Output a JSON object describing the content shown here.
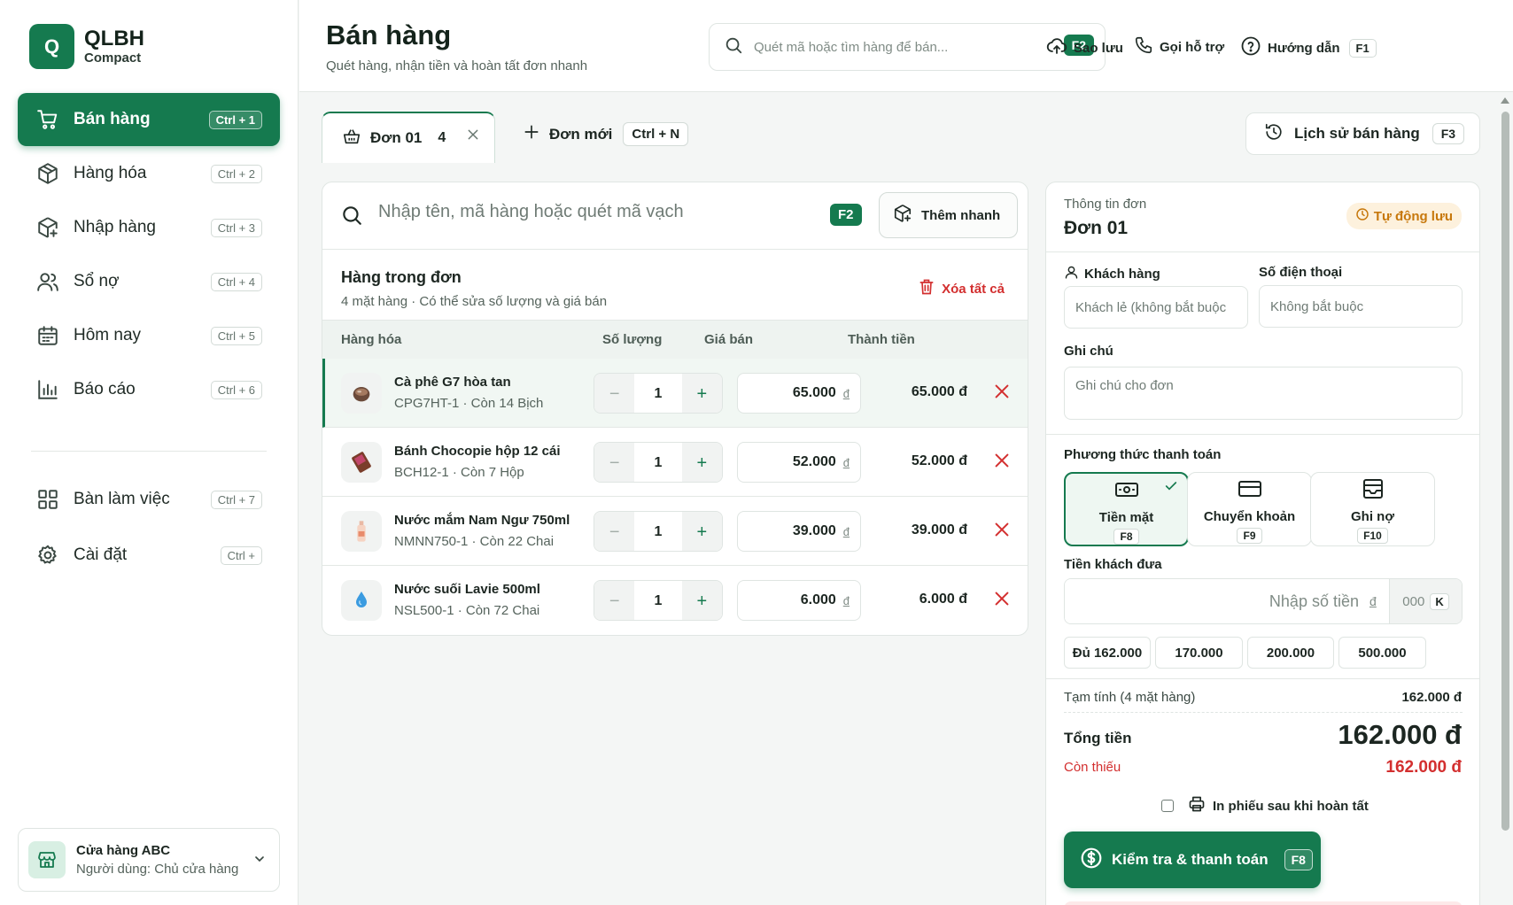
{
  "brand": {
    "logo_letter": "Q",
    "title": "QLBH",
    "subtitle": "Compact"
  },
  "sidebar": {
    "items": [
      {
        "label": "Bán hàng",
        "shortcut": "Ctrl + 1",
        "icon": "cart-icon",
        "active": true
      },
      {
        "label": "Hàng hóa",
        "shortcut": "Ctrl + 2",
        "icon": "box-icon"
      },
      {
        "label": "Nhập hàng",
        "shortcut": "Ctrl + 3",
        "icon": "box-import-icon"
      },
      {
        "label": "Sổ nợ",
        "shortcut": "Ctrl + 4",
        "icon": "users-icon"
      },
      {
        "label": "Hôm nay",
        "shortcut": "Ctrl + 5",
        "icon": "calendar-icon"
      },
      {
        "label": "Báo cáo",
        "shortcut": "Ctrl + 6",
        "icon": "bar-chart-icon"
      },
      {
        "label": "Bàn làm việc",
        "shortcut": "Ctrl + 7",
        "icon": "grid-icon"
      },
      {
        "label": "Cài đặt",
        "shortcut": "Ctrl +",
        "icon": "gear-icon"
      }
    ],
    "store": {
      "name": "Cửa hàng ABC",
      "user": "Người dùng: Chủ cửa hàng"
    }
  },
  "header": {
    "title": "Bán hàng",
    "subtitle": "Quét hàng, nhận tiền và hoàn tất đơn nhanh",
    "search_placeholder": "Quét mã hoặc tìm hàng để bán...",
    "search_shortcut": "F2",
    "backup": "Sao lưu",
    "support": "Gọi hỗ trợ",
    "guide": "Hướng dẫn",
    "guide_shortcut": "F1"
  },
  "tabs": {
    "active_label": "Đơn 01",
    "active_count": "4",
    "new_label": "Đơn mới",
    "new_shortcut": "Ctrl + N",
    "history_label": "Lịch sử bán hàng",
    "history_shortcut": "F3"
  },
  "order": {
    "search_placeholder": "Nhập tên, mã hàng hoặc quét mã vạch",
    "search_shortcut": "F2",
    "quick_add": "Thêm nhanh",
    "list_title": "Hàng trong đơn",
    "list_subtitle": "4 mặt hàng · Có thể sửa số lượng và giá bán",
    "clear_all": "Xóa tất cả",
    "columns": [
      "Hàng hóa",
      "Số lượng",
      "Giá bán",
      "Thành tiền"
    ],
    "currency": "đ",
    "items": [
      {
        "name": "Cà phê G7 hòa tan",
        "sku": "CPG7HT-1 · Còn 14 Bịch",
        "qty": "1",
        "price": "65.000",
        "total": "65.000 đ",
        "icon": "coffee-icon"
      },
      {
        "name": "Bánh Chocopie hộp 12 cái",
        "sku": "BCH12-1 · Còn 7 Hộp",
        "qty": "1",
        "price": "52.000",
        "total": "52.000 đ",
        "icon": "chocolate-icon"
      },
      {
        "name": "Nước mắm Nam Ngư 750ml",
        "sku": "NMNN750-1 · Còn 22 Chai",
        "qty": "1",
        "price": "39.000",
        "total": "39.000 đ",
        "icon": "bottle-icon"
      },
      {
        "name": "Nước suối Lavie 500ml",
        "sku": "NSL500-1 · Còn 72 Chai",
        "qty": "1",
        "price": "6.000",
        "total": "6.000 đ",
        "icon": "water-drop-icon"
      }
    ]
  },
  "panel": {
    "label": "Thông tin đơn",
    "title": "Đơn 01",
    "autosave": "Tự động lưu",
    "customer_label": "Khách hàng",
    "customer_placeholder": "Khách lẻ (không bắt buộc",
    "phone_label": "Số điện thoại",
    "phone_placeholder": "Không bắt buộc",
    "note_label": "Ghi chú",
    "note_placeholder": "Ghi chú cho đơn",
    "payment_label": "Phương thức thanh toán",
    "methods": [
      {
        "label": "Tiền mặt",
        "key": "F8",
        "icon": "cash-icon",
        "active": true
      },
      {
        "label": "Chuyển khoản",
        "key": "F9",
        "icon": "card-icon"
      },
      {
        "label": "Ghi nợ",
        "key": "F10",
        "icon": "ledger-icon"
      }
    ],
    "cash_label": "Tiền khách đưa",
    "cash_placeholder": "Nhập số tiền",
    "cash_currency": "đ",
    "cash_suffix": "000",
    "cash_suffix_key": "K",
    "quick_amounts": [
      "Đủ 162.000",
      "170.000",
      "200.000",
      "500.000"
    ],
    "subtotal_label": "Tạm tính (4 mặt hàng)",
    "subtotal_value": "162.000 đ",
    "total_label": "Tổng tiền",
    "total_value": "162.000 đ",
    "owe_label": "Còn thiếu",
    "owe_value": "162.000 đ",
    "print_label": "In phiếu sau khi hoàn tất",
    "pay_button": "Kiểm tra & thanh toán",
    "pay_shortcut": "F8"
  },
  "colors": {
    "brand": "#157a4f",
    "danger": "#d32f2f",
    "warning": "#c7780c"
  }
}
